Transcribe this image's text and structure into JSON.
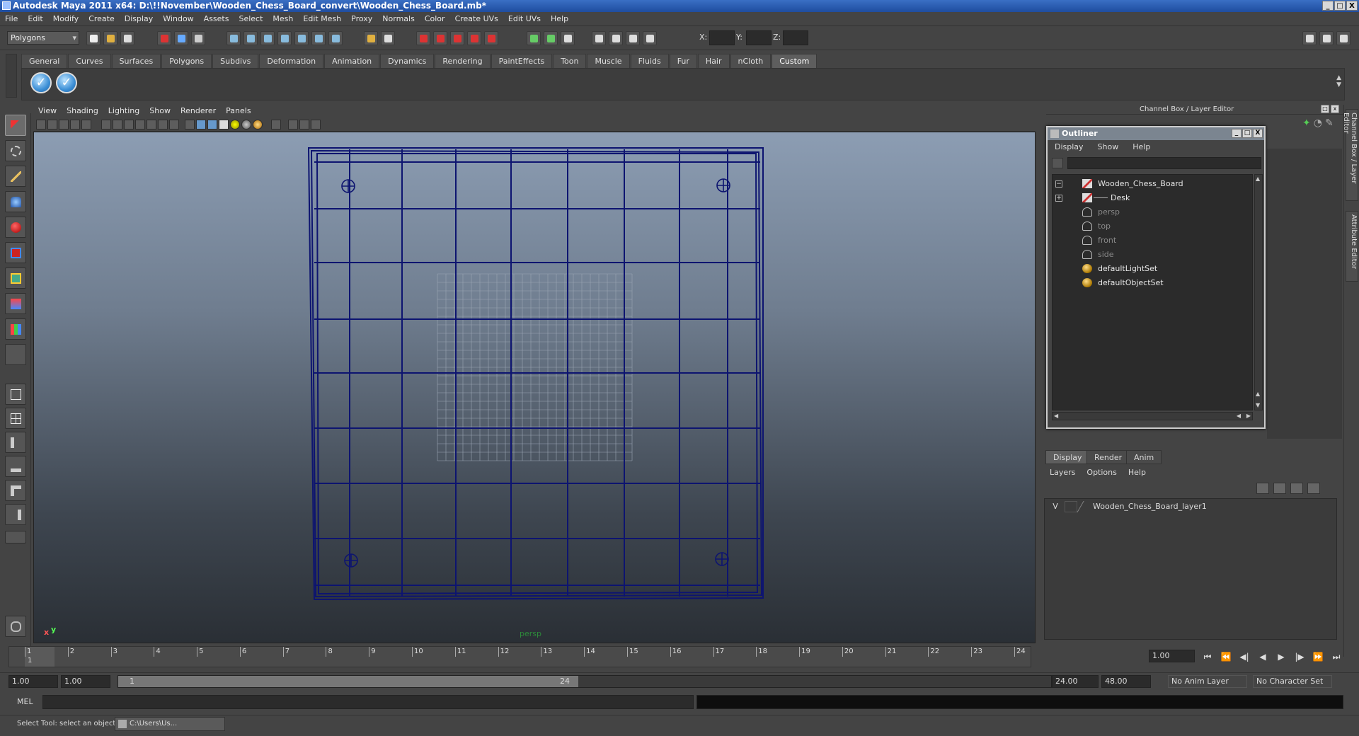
{
  "window": {
    "title": "Autodesk Maya 2011 x64: D:\\!!November\\Wooden_Chess_Board_convert\\Wooden_Chess_Board.mb*",
    "controls": [
      "_",
      "□",
      "X"
    ]
  },
  "menubar": [
    "File",
    "Edit",
    "Modify",
    "Create",
    "Display",
    "Window",
    "Assets",
    "Select",
    "Mesh",
    "Edit Mesh",
    "Proxy",
    "Normals",
    "Color",
    "Create UVs",
    "Edit UVs",
    "Help"
  ],
  "statusline": {
    "mode": "Polygons",
    "coord_labels": [
      "X:",
      "Y:",
      "Z:"
    ]
  },
  "shelf": {
    "tabs": [
      "General",
      "Curves",
      "Surfaces",
      "Polygons",
      "Subdivs",
      "Deformation",
      "Animation",
      "Dynamics",
      "Rendering",
      "PaintEffects",
      "Toon",
      "Muscle",
      "Fluids",
      "Fur",
      "Hair",
      "nCloth",
      "Custom"
    ],
    "active_tab": "Custom"
  },
  "viewport": {
    "menu": [
      "View",
      "Shading",
      "Lighting",
      "Show",
      "Renderer",
      "Panels"
    ],
    "camera_label": "persp",
    "axis": {
      "x": "x",
      "y": "y"
    }
  },
  "channelbox": {
    "title": "Channel Box / Layer Editor",
    "side_tabs": [
      "Channel Box / Layer Editor",
      "Attribute Editor"
    ]
  },
  "outliner": {
    "title": "Outliner",
    "menu": [
      "Display",
      "Show",
      "Help"
    ],
    "items": [
      {
        "label": "Wooden_Chess_Board",
        "icon": "mesh-icon",
        "expander": "−",
        "dim": false
      },
      {
        "label": "Desk",
        "icon": "mesh-icon",
        "expander": "+",
        "dim": false
      },
      {
        "label": "persp",
        "icon": "camera-icon",
        "expander": "",
        "dim": true
      },
      {
        "label": "top",
        "icon": "camera-icon",
        "expander": "",
        "dim": true
      },
      {
        "label": "front",
        "icon": "camera-icon",
        "expander": "",
        "dim": true
      },
      {
        "label": "side",
        "icon": "camera-icon",
        "expander": "",
        "dim": true
      },
      {
        "label": "defaultLightSet",
        "icon": "set-icon",
        "expander": "",
        "dim": false
      },
      {
        "label": "defaultObjectSet",
        "icon": "set-icon",
        "expander": "",
        "dim": false
      }
    ]
  },
  "layers": {
    "tabs": [
      "Display",
      "Render",
      "Anim"
    ],
    "menu": [
      "Layers",
      "Options",
      "Help"
    ],
    "rows": [
      {
        "visible": "V",
        "name": "Wooden_Chess_Board_layer1"
      }
    ]
  },
  "timeline": {
    "ticks": [
      "1",
      "2",
      "3",
      "4",
      "5",
      "6",
      "7",
      "8",
      "9",
      "10",
      "11",
      "12",
      "13",
      "14",
      "15",
      "16",
      "17",
      "18",
      "19",
      "20",
      "21",
      "22",
      "23",
      "24"
    ],
    "current_frame_marker": "1",
    "current_time": "1.00"
  },
  "range": {
    "start": "1.00",
    "playback_start": "1.00",
    "slider_start": "1",
    "slider_end": "24",
    "playback_end": "24.00",
    "end": "48.00",
    "anim_layer": "No Anim Layer",
    "character_set": "No Character Set"
  },
  "mel": {
    "label": "MEL"
  },
  "status": {
    "help_text": "Select Tool: select an object",
    "taskbar_item": "C:\\Users\\Us..."
  }
}
